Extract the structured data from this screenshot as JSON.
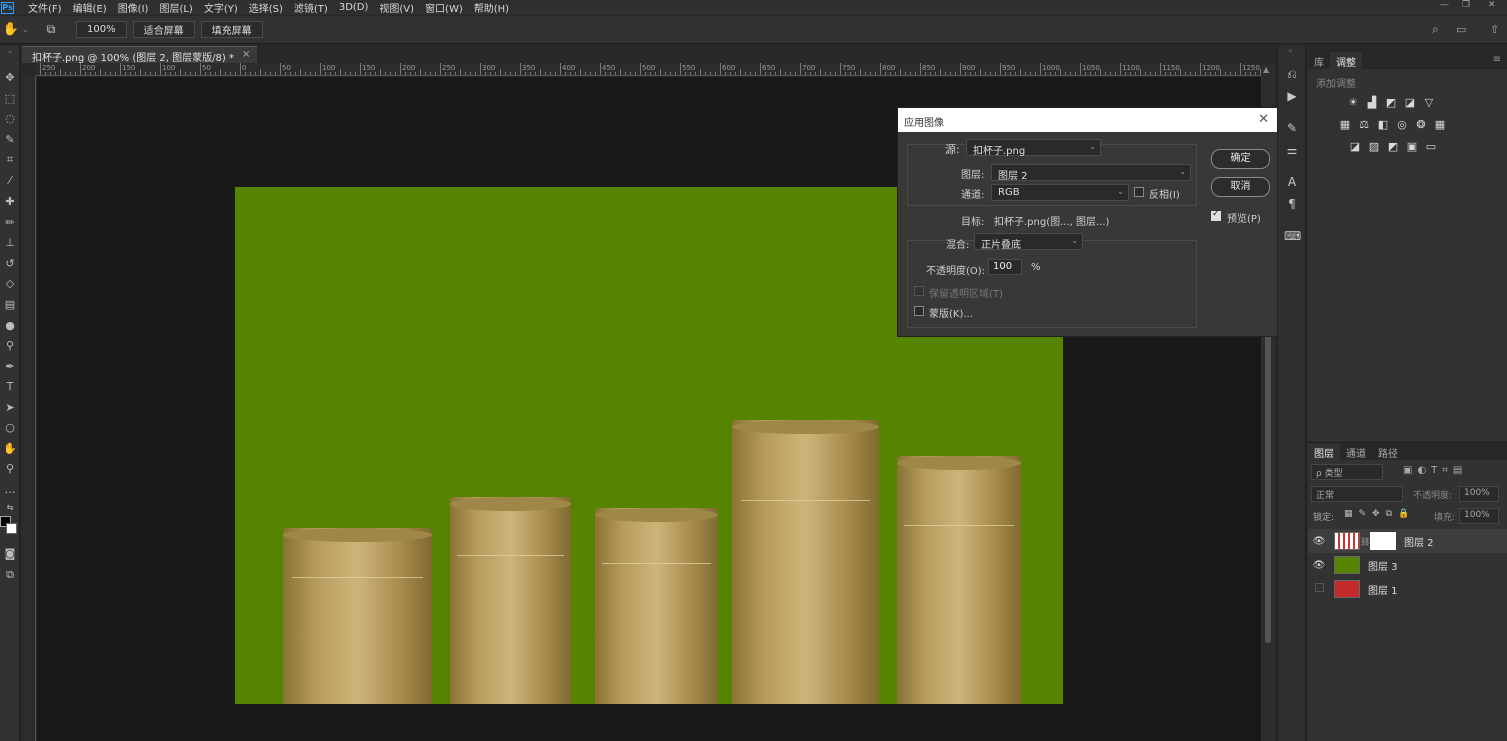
{
  "menubar": {
    "logo": "Ps",
    "items": [
      "文件(F)",
      "编辑(E)",
      "图像(I)",
      "图层(L)",
      "文字(Y)",
      "选择(S)",
      "滤镜(T)",
      "3D(D)",
      "视图(V)",
      "窗口(W)",
      "帮助(H)"
    ]
  },
  "options": {
    "zoom": "100%",
    "fit_screen": "适合屏幕",
    "fill_screen": "填充屏幕"
  },
  "document": {
    "tab_title": "扣杯子.png @ 100% (图层 2, 图层蒙版/8) *",
    "tab_close": "×"
  },
  "ruler": {
    "labels": [
      "250",
      "200",
      "150",
      "100",
      "50",
      "0",
      "50",
      "100",
      "150",
      "200",
      "250",
      "300",
      "350",
      "400",
      "450",
      "500",
      "550",
      "600",
      "650",
      "700",
      "750",
      "800",
      "850",
      "900",
      "950",
      "1000",
      "1050",
      "1100",
      "1150",
      "1200",
      "1250"
    ]
  },
  "colors": {
    "canvas_green": "#558400",
    "glass": "#b59b5c",
    "accent": "#2e9ffa"
  },
  "glasses": [
    {
      "left": 0.058,
      "width": 0.18,
      "height": 0.34
    },
    {
      "left": 0.26,
      "width": 0.146,
      "height": 0.4
    },
    {
      "left": 0.435,
      "width": 0.148,
      "height": 0.38
    },
    {
      "left": 0.6,
      "width": 0.178,
      "height": 0.55
    },
    {
      "left": 0.8,
      "width": 0.15,
      "height": 0.48
    }
  ],
  "right_panel": {
    "tab_library": "库",
    "tab_adjust": "调整",
    "add_adjust": "添加调整",
    "layers_tab": "图层",
    "channels_tab": "通道",
    "paths_tab": "路径",
    "filter_kind": "ρ 类型",
    "blend_mode": "正常",
    "opacity_label": "不透明度:",
    "opacity_value": "100%",
    "lock_label": "锁定:",
    "fill_label": "填充:",
    "fill_value": "100%",
    "layers": [
      {
        "name": "图层 2",
        "visible": true,
        "selected": true
      },
      {
        "name": "图层 3",
        "visible": true,
        "selected": false
      },
      {
        "name": "图层 1",
        "visible": false,
        "selected": false
      }
    ]
  },
  "dialog": {
    "title": "应用图像",
    "close": "✕",
    "source_label": "源:",
    "source_value": "扣杯子.png",
    "layer_label": "图层:",
    "layer_value": "图层 2",
    "channel_label": "通道:",
    "channel_value": "RGB",
    "invert_label": "反相(I)",
    "target_label": "目标:",
    "target_value": "扣杯子.png(图..., 图层...)",
    "blend_label": "混合:",
    "blend_value": "正片叠底",
    "opacity_label": "不透明度(O):",
    "opacity_value": "100",
    "percent": "%",
    "preserve_label": "保留透明区域(T)",
    "mask_label": "蒙版(K)...",
    "ok": "确定",
    "cancel": "取消",
    "preview": "预览(P)",
    "preview_checked": true
  }
}
